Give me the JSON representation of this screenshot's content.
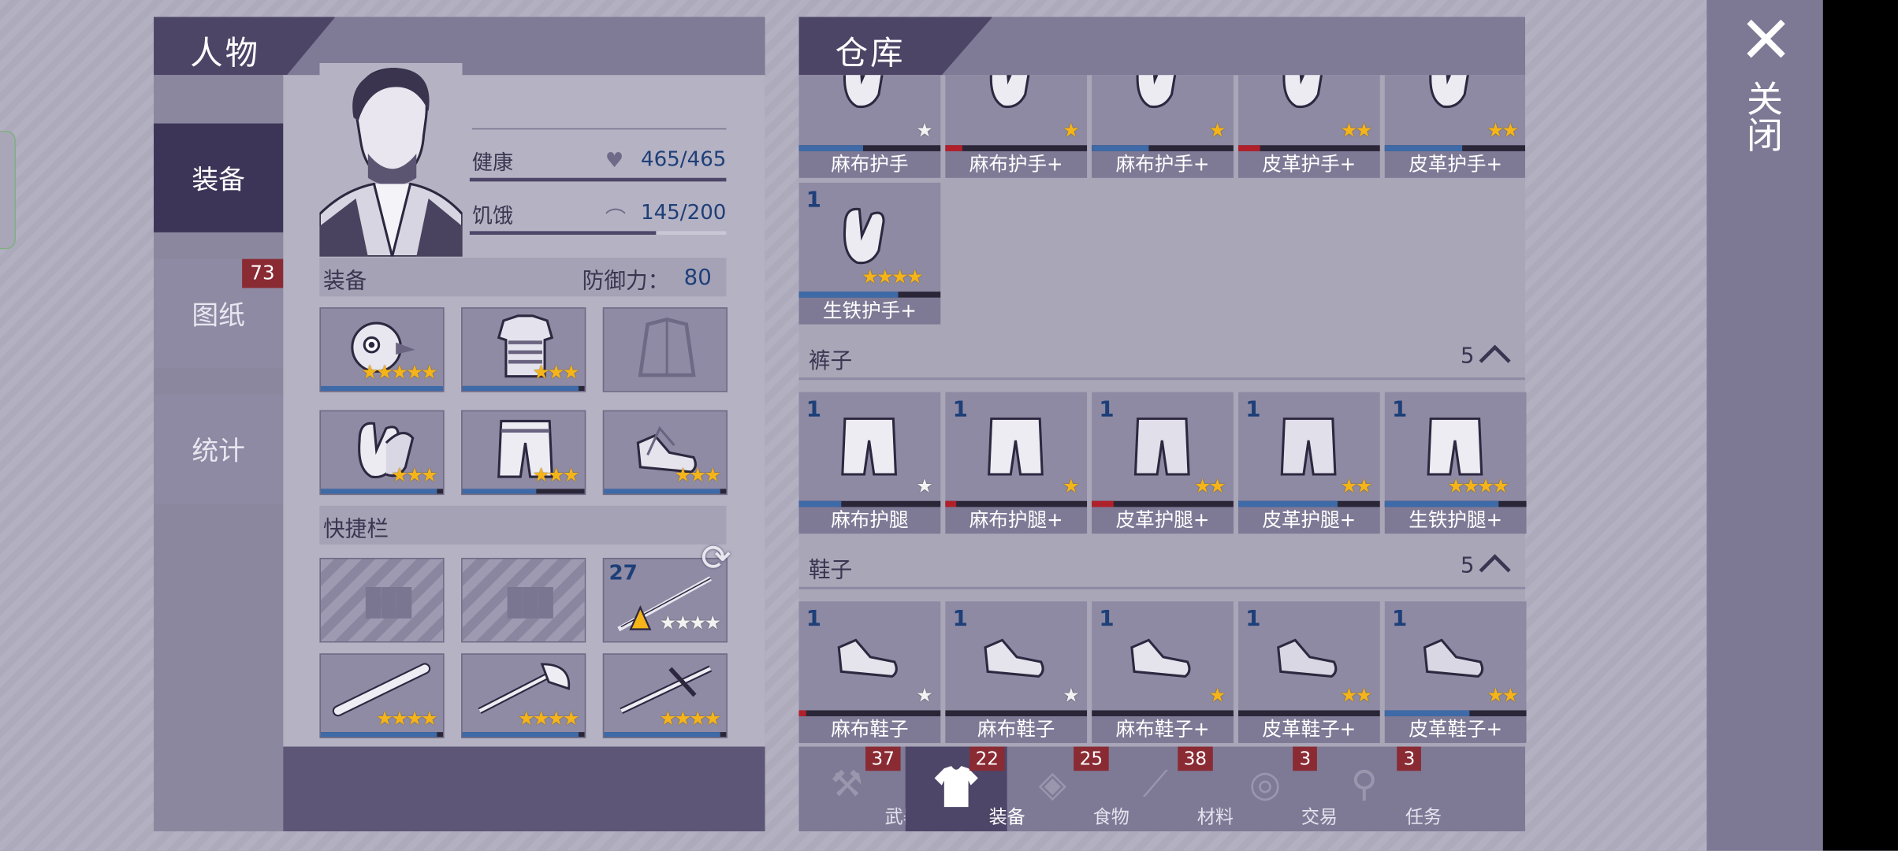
{
  "character": {
    "title": "人物",
    "tabs": [
      {
        "label": "装备",
        "active": true
      },
      {
        "label": "图纸",
        "badge": "73"
      },
      {
        "label": "统计"
      }
    ],
    "stats": [
      {
        "label": "健康",
        "value": "465/465",
        "fill": 1.0,
        "icon": "heart-icon"
      },
      {
        "label": "饥饿",
        "value": "145/200",
        "fill": 0.725,
        "icon": "stomach-icon"
      }
    ],
    "equipment": {
      "label": "装备",
      "defense_label": "防御力：",
      "defense_value": "80",
      "slots": [
        {
          "icon": "plague-mask-icon",
          "stars": 5,
          "durability": 1.0
        },
        {
          "icon": "armor-vest-icon",
          "stars": 3,
          "durability": 0.95
        },
        {
          "icon": "jacket-empty-icon",
          "stars": 0,
          "durability": null
        },
        {
          "icon": "gloves-icon",
          "stars": 3,
          "durability": 0.95
        },
        {
          "icon": "pants-icon",
          "stars": 3,
          "durability": 0.6
        },
        {
          "icon": "shoes-icon",
          "stars": 3,
          "durability": 0.95
        }
      ]
    },
    "quickbar": {
      "label": "快捷栏",
      "slots": [
        {
          "icon": "empty-ammo-icon",
          "stars": 0
        },
        {
          "icon": "empty-ammo-icon",
          "stars": 0
        },
        {
          "icon": "torch-spear-icon",
          "count": "27",
          "stars": 4,
          "stars_white": 3,
          "durability": null
        },
        {
          "icon": "bat-icon",
          "stars": 4,
          "durability": 0.95
        },
        {
          "icon": "axe-icon",
          "stars": 4,
          "durability": 0.95
        },
        {
          "icon": "crossbow-icon",
          "stars": 4,
          "durability": 0.95
        }
      ]
    }
  },
  "storage": {
    "title": "仓库",
    "close_label": "关闭",
    "gloves_row": [
      {
        "name": "麻布护手",
        "stars": 1,
        "star_white": true,
        "bar_color": "#3e6aa7",
        "bar": 0.45
      },
      {
        "name": "麻布护手+",
        "stars": 1,
        "bar_color": "#b0202a",
        "bar": 0.12
      },
      {
        "name": "麻布护手+",
        "stars": 1,
        "bar_color": "#3e6aa7",
        "bar": 0.4
      },
      {
        "name": "皮革护手+",
        "stars": 2,
        "bar_color": "#b0202a",
        "bar": 0.15
      },
      {
        "name": "皮革护手+",
        "stars": 2,
        "bar_color": "#3e6aa7",
        "bar": 0.55
      },
      {
        "name": "生铁护手+",
        "count": "1",
        "stars": 4,
        "bar_color": "#3e6aa7",
        "bar": 0.7
      }
    ],
    "pants_section": {
      "label": "裤子",
      "count": "5"
    },
    "pants": [
      {
        "name": "麻布护腿",
        "count": "1",
        "stars": 1,
        "star_white": true,
        "bar_color": "#3e6aa7",
        "bar": 0.3
      },
      {
        "name": "麻布护腿+",
        "count": "1",
        "stars": 1,
        "bar_color": "#b0202a",
        "bar": 0.08
      },
      {
        "name": "皮革护腿+",
        "count": "1",
        "stars": 2,
        "bar_color": "#b0202a",
        "bar": 0.15
      },
      {
        "name": "皮革护腿+",
        "count": "1",
        "stars": 2,
        "bar_color": "#3e6aa7",
        "bar": 0.7
      },
      {
        "name": "生铁护腿+",
        "count": "1",
        "stars": 4,
        "bar_color": "#3e6aa7",
        "bar": 0.8
      }
    ],
    "shoes_section": {
      "label": "鞋子",
      "count": "5"
    },
    "shoes": [
      {
        "name": "麻布鞋子",
        "count": "1",
        "stars": 1,
        "star_white": true,
        "bar_color": "#b0202a",
        "bar": 0.05
      },
      {
        "name": "麻布鞋子",
        "count": "1",
        "stars": 1,
        "star_white": true,
        "bar_color": "#3e6aa7",
        "bar": 0.0
      },
      {
        "name": "麻布鞋子+",
        "count": "1",
        "stars": 1,
        "bar_color": "#b0202a",
        "bar": 0.0
      },
      {
        "name": "皮革鞋子+",
        "count": "1",
        "stars": 2,
        "bar_color": "#3e6aa7",
        "bar": 0.0
      },
      {
        "name": "皮革鞋子+",
        "count": "1",
        "stars": 2,
        "bar_color": "#3e6aa7",
        "bar": 0.6
      }
    ],
    "bottom_tabs": [
      {
        "label": "武器",
        "badge": "37",
        "icon": "weapon-icon"
      },
      {
        "label": "装备",
        "badge": "22",
        "icon": "shirt-icon",
        "active": true
      },
      {
        "label": "食物",
        "badge": "25",
        "icon": "food-icon"
      },
      {
        "label": "材料",
        "badge": "38",
        "icon": "material-icon"
      },
      {
        "label": "交易",
        "badge": "3",
        "icon": "trade-icon"
      },
      {
        "label": "任务",
        "badge": "3",
        "icon": "quest-icon"
      }
    ]
  }
}
